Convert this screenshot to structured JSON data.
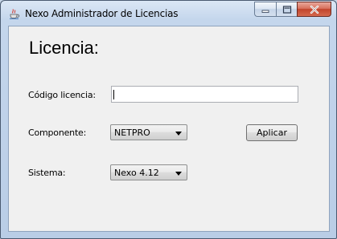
{
  "window": {
    "title": "Nexo Administrador de Licencias",
    "app_icon": "java-cup-icon",
    "caption_buttons": [
      "minimize-icon",
      "maximize-icon",
      "close-icon"
    ]
  },
  "form": {
    "heading": "Licencia:",
    "codigo": {
      "label": "Código licencia:",
      "value": "",
      "placeholder": ""
    },
    "componente": {
      "label": "Componente:",
      "selected": "NETPRO"
    },
    "aplicar_label": "Aplicar",
    "sistema": {
      "label": "Sistema:",
      "selected": "Nexo 4.12"
    }
  },
  "colors": {
    "titlebar": "#b9cde6",
    "client_background": "#f0f0f0",
    "close_button": "#c1442c"
  }
}
